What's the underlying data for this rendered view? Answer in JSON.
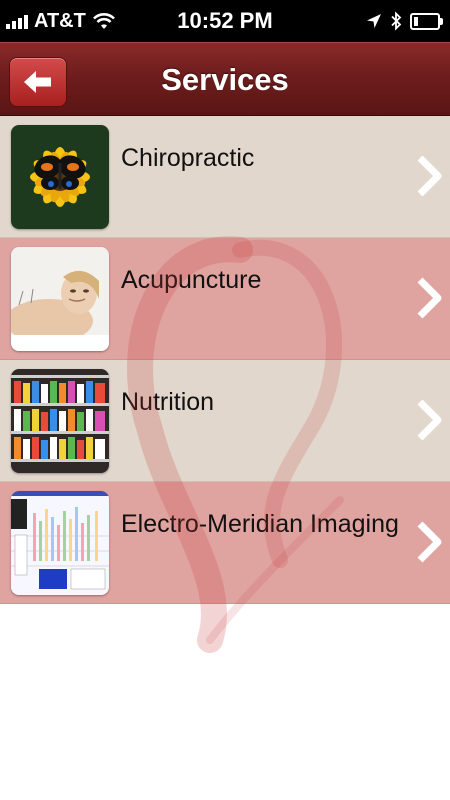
{
  "status_bar": {
    "carrier": "AT&T",
    "time": "10:52 PM",
    "icons": [
      "signal-icon",
      "wifi-icon",
      "location-icon",
      "bluetooth-icon",
      "battery-icon"
    ],
    "battery_level": 0.2
  },
  "nav": {
    "title": "Services",
    "back_icon": "back-arrow-icon"
  },
  "services": [
    {
      "label": "Chiropractic",
      "thumb": "sunflower-butterfly",
      "style": "a"
    },
    {
      "label": "Acupuncture",
      "thumb": "relaxed-woman",
      "style": "b"
    },
    {
      "label": "Nutrition",
      "thumb": "supplement-shelves",
      "style": "a"
    },
    {
      "label": "Electro-Meridian Imaging",
      "thumb": "meridian-chart",
      "style": "b"
    }
  ],
  "colors": {
    "nav_bar": "#6e1d1d",
    "row_light": "#e1d7cc",
    "row_rose": "#dfa3a0",
    "back_button": "#c03535"
  }
}
